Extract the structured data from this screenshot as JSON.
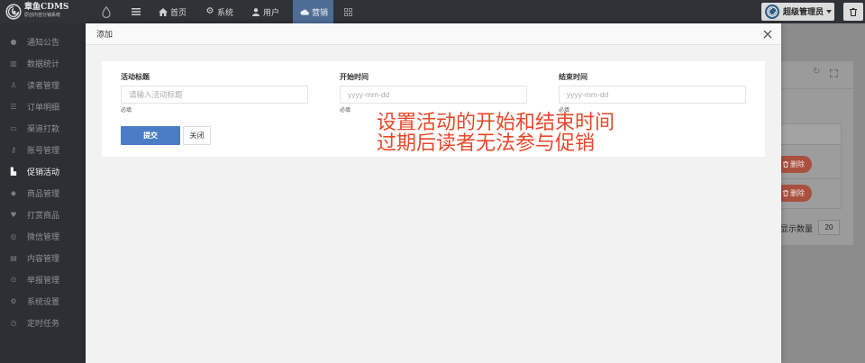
{
  "colors": {
    "accent": "#4e6d96",
    "submit": "#4b7dc6",
    "danger": "#a9503f",
    "annot": "#e8472a"
  },
  "header": {
    "brand": {
      "name": "章鱼CDMS",
      "tagline": "原创内容分销系统"
    },
    "nav": [
      {
        "label": "首页",
        "icon": "home-icon"
      },
      {
        "label": "系统",
        "icon": "gear-icon"
      },
      {
        "label": "用户",
        "icon": "user-icon"
      },
      {
        "label": "营销",
        "icon": "cloud-icon",
        "active": true
      }
    ],
    "user": {
      "name": "超级管理员",
      "icon": "avatar-icon"
    }
  },
  "sidebar": {
    "items": [
      {
        "label": "通知公告",
        "icon": "chat-icon"
      },
      {
        "label": "数据统计",
        "icon": "bar-chart-icon"
      },
      {
        "label": "读者管理",
        "icon": "reader-icon"
      },
      {
        "label": "订单明细",
        "icon": "list-icon"
      },
      {
        "label": "渠道打款",
        "icon": "credit-card-icon"
      },
      {
        "label": "账号管理",
        "icon": "key-icon"
      },
      {
        "label": "促销活动",
        "icon": "shopping-bag-icon",
        "active": true
      },
      {
        "label": "商品管理",
        "icon": "diamond-icon"
      },
      {
        "label": "打赏商品",
        "icon": "heart-icon"
      },
      {
        "label": "微信管理",
        "icon": "wechat-icon"
      },
      {
        "label": "内容管理",
        "icon": "file-icon"
      },
      {
        "label": "举报管理",
        "icon": "report-icon"
      },
      {
        "label": "系统设置",
        "icon": "settings-icon"
      },
      {
        "label": "定时任务",
        "icon": "clock-icon"
      }
    ]
  },
  "background_page": {
    "table_rows": [
      {
        "action": "删除"
      },
      {
        "action": "删除"
      }
    ],
    "pagination": {
      "label": "显示数量",
      "page_size": "20"
    }
  },
  "modal": {
    "title": "添加",
    "fields": [
      {
        "label": "活动标题",
        "placeholder": "请输入活动标题",
        "hint": "必填"
      },
      {
        "label": "开始时间",
        "placeholder": "yyyy-mm-dd",
        "hint": "必填"
      },
      {
        "label": "结束时间",
        "placeholder": "yyyy-mm-dd",
        "hint": "必填"
      }
    ],
    "submit_label": "提交",
    "close_label": "关闭"
  },
  "annotation": {
    "lines": [
      "设置活动的开始和结束时间",
      "过期后读者无法参与促销"
    ]
  }
}
